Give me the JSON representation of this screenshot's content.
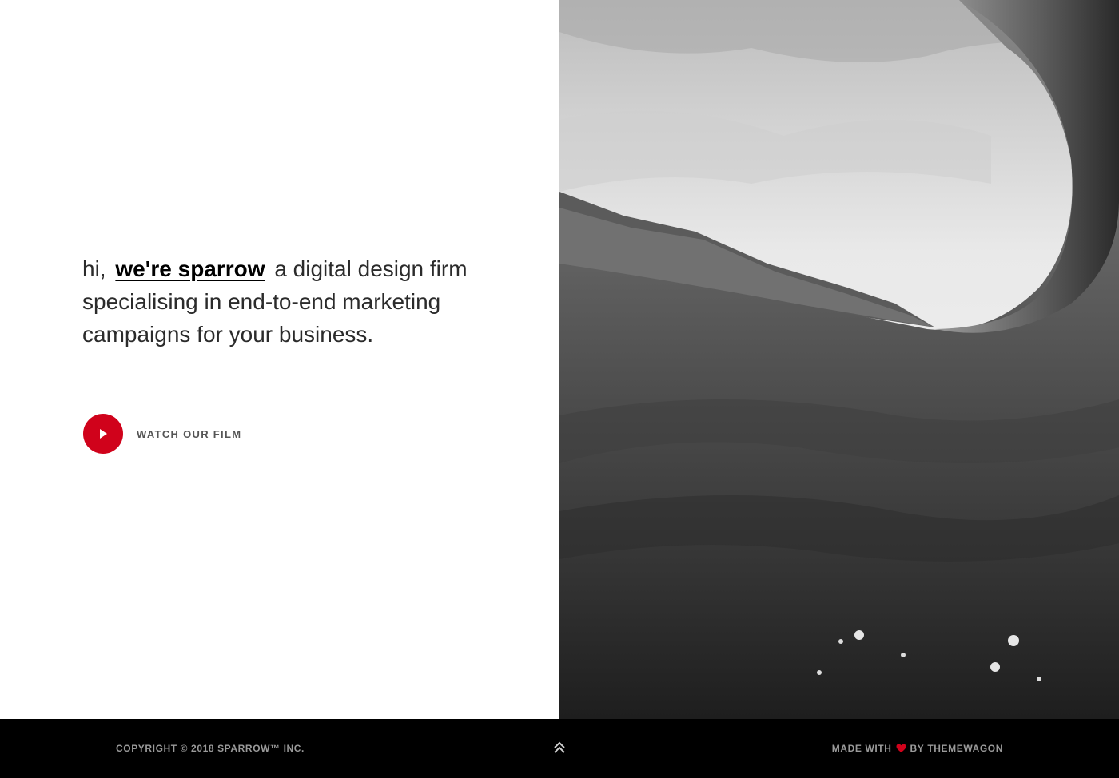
{
  "hero": {
    "greeting": "hi,",
    "brand_link": "we're sparrow",
    "tagline": "a digital design firm specialising in end-to-end marketing campaigns for your business.",
    "film_label": "WATCH OUR FILM",
    "image_alt": "wave-photo",
    "play_icon": "play-icon"
  },
  "footer": {
    "copyright": "COPYRIGHT © 2018 SPARROW™ INC.",
    "made_with": "MADE WITH",
    "by": "BY",
    "author": "THEMEWAGON",
    "back_to_top_icon": "double-chevron-up-icon",
    "heart_icon": "heart-icon"
  },
  "colors": {
    "accent": "#d0021b",
    "footer_bg": "#000000",
    "footer_text": "#9a9a9a"
  }
}
